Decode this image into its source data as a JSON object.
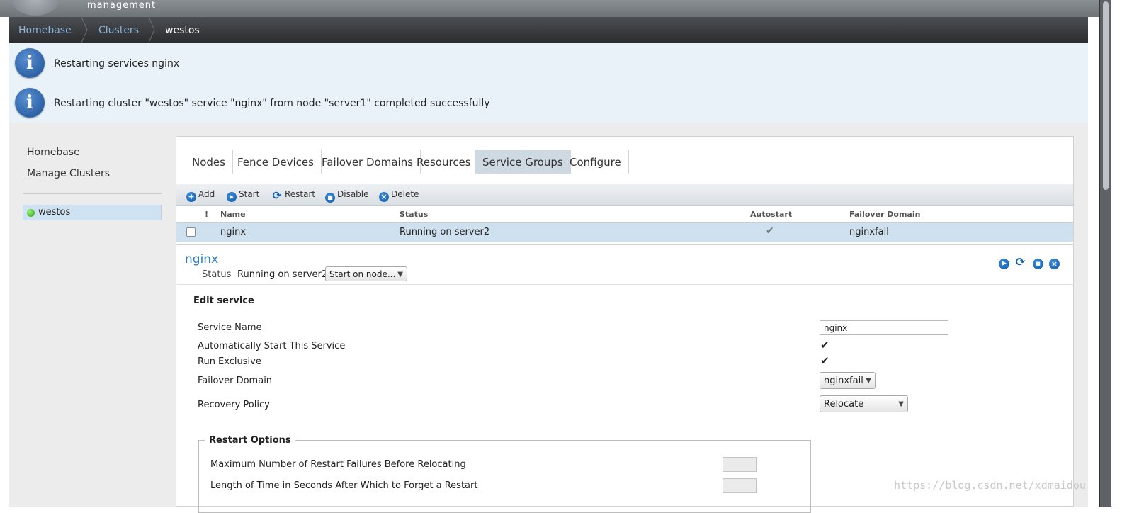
{
  "header": {
    "brand_subtitle": "management"
  },
  "breadcrumb": {
    "items": [
      "Homebase",
      "Clusters",
      "westos"
    ]
  },
  "notices": [
    "Restarting services nginx",
    "Restarting cluster \"westos\" service \"nginx\" from node \"server1\" completed successfully"
  ],
  "sidebar": {
    "links": [
      "Homebase",
      "Manage Clusters"
    ],
    "cluster": {
      "name": "westos",
      "status_color": "#21a10c"
    }
  },
  "tabs": [
    "Nodes",
    "Fence Devices",
    "Failover Domains",
    "Resources",
    "Service Groups",
    "Configure"
  ],
  "active_tab": "Service Groups",
  "toolbar": {
    "add": "Add",
    "start": "Start",
    "restart": "Restart",
    "disable": "Disable",
    "delete": "Delete"
  },
  "table": {
    "headers": {
      "alert": "!",
      "name": "Name",
      "status": "Status",
      "autostart": "Autostart",
      "failover": "Failover Domain"
    },
    "rows": [
      {
        "name": "nginx",
        "status": "Running on server2",
        "autostart": true,
        "failover": "nginxfail",
        "selected": false
      }
    ]
  },
  "service": {
    "title": "nginx",
    "status_label": "Status",
    "status_value": "Running on server2",
    "start_on_node": "Start on node..."
  },
  "edit": {
    "title": "Edit service",
    "service_name_label": "Service Name",
    "service_name_value": "nginx",
    "autostart_label": "Automatically Start This Service",
    "autostart_checked": true,
    "exclusive_label": "Run Exclusive",
    "exclusive_checked": true,
    "failover_label": "Failover Domain",
    "failover_value": "nginxfail",
    "recovery_label": "Recovery Policy",
    "recovery_value": "Relocate"
  },
  "restart_options": {
    "legend": "Restart Options",
    "max_failures_label": "Maximum Number of Restart Failures Before Relocating",
    "max_failures_value": "",
    "forget_label": "Length of Time in Seconds After Which to Forget a Restart",
    "forget_value": ""
  },
  "watermark": "https://blog.csdn.net/xdmaidou",
  "colors": {
    "accent": "#2b7dbf",
    "selected_row": "#cfe0ee",
    "notice_bg": "#e8f2f8"
  }
}
